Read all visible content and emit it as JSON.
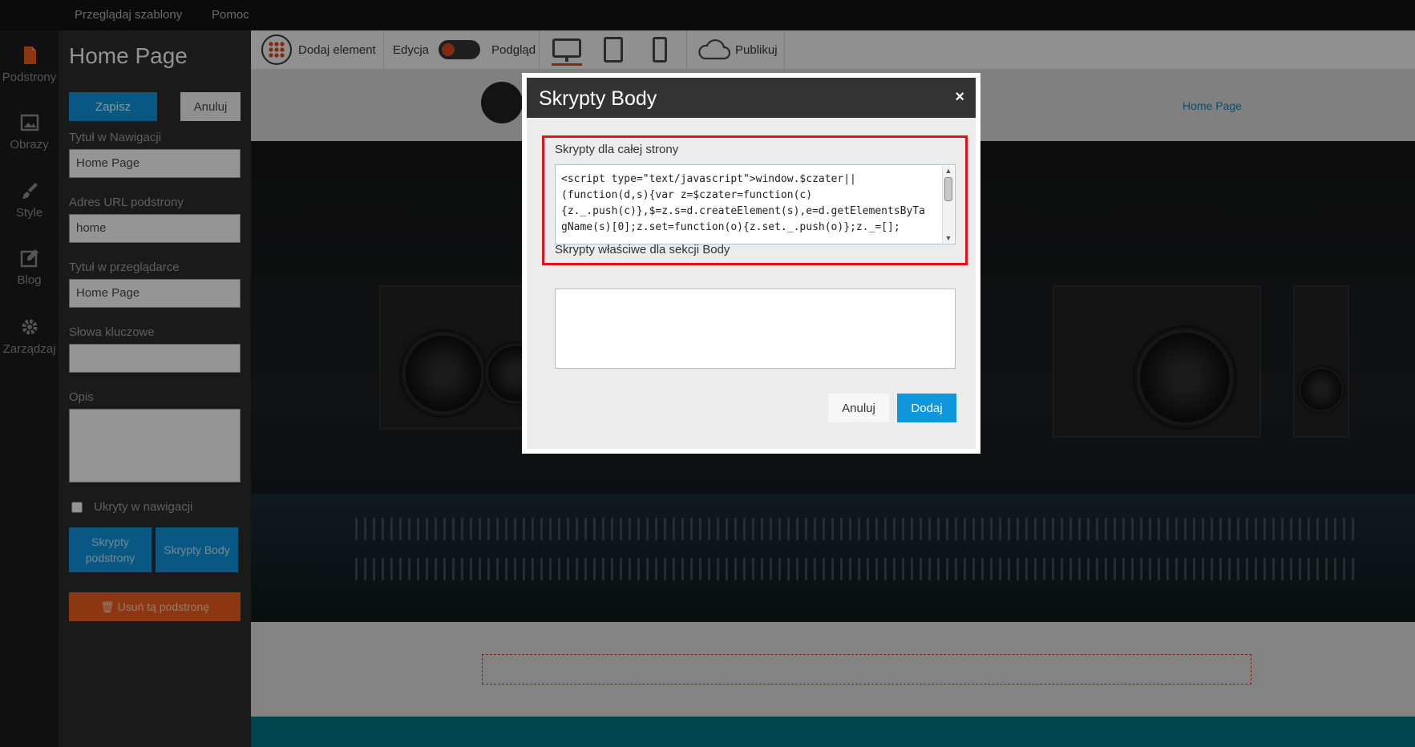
{
  "topbar": {
    "browse_templates": "Przeglądaj szablony",
    "help": "Pomoc"
  },
  "rail": {
    "items": [
      {
        "label": "Podstrony",
        "icon": "page-icon"
      },
      {
        "label": "Obrazy",
        "icon": "image-icon"
      },
      {
        "label": "Style",
        "icon": "brush-icon"
      },
      {
        "label": "Blog",
        "icon": "edit-icon"
      },
      {
        "label": "Zarządzaj",
        "icon": "gear-icon"
      }
    ]
  },
  "panel": {
    "title": "Home Page",
    "save": "Zapisz",
    "cancel": "Anuluj",
    "nav_title_label": "Tytuł w Nawigacji",
    "nav_title_value": "Home Page",
    "url_label": "Adres URL podstrony",
    "url_value": "home",
    "browser_title_label": "Tytuł w przeglądarce",
    "browser_title_value": "Home Page",
    "keywords_label": "Słowa kluczowe",
    "keywords_value": "",
    "description_label": "Opis",
    "hidden_label": "Ukryty w nawigacji",
    "page_scripts": "Skrypty podstrony",
    "body_scripts": "Skrypty Body",
    "delete": "Usuń tą podstronę"
  },
  "toolbar": {
    "add_element": "Dodaj element",
    "edit": "Edycja",
    "preview": "Podgląd",
    "publish": "Publikuj"
  },
  "site": {
    "nav_home": "Home Page"
  },
  "modal": {
    "title": "Skrypty Body",
    "close": "×",
    "site_scripts_label": "Skrypty dla całej strony",
    "code_lines": [
      "<script type=\"text/javascript\">window.$czater||",
      "(function(d,s){var z=$czater=function(c)",
      "{z._.push(c)},$=z.s=d.createElement(s),e=d.getElementsByTa",
      "gName(s)[0];z.set=function(o){z.set._.push(o)};z._=[];"
    ],
    "body_scripts_label": "Skrypty właściwe dla sekcji Body",
    "cancel": "Anuluj",
    "add": "Dodaj"
  },
  "colors": {
    "accent_blue": "#0f96dd",
    "highlight_red": "#e0151b",
    "danger_orange": "#e35a1c"
  }
}
